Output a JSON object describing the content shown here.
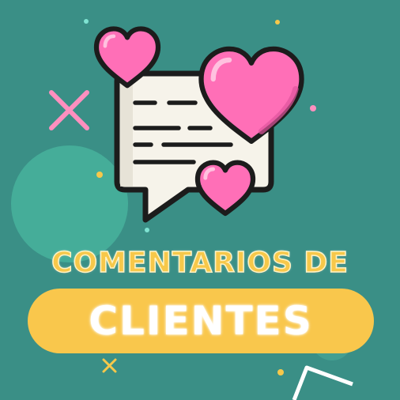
{
  "title": {
    "line1": "COMENTARIOS DE",
    "line2": "CLIENTES"
  },
  "icon_names": [
    "speech-bubble-icon",
    "heart-icon"
  ],
  "colors": {
    "background": "#3a8f86",
    "blob": "#45ad99",
    "heart": "#ff6fb7",
    "bubble": "#f6f3ea",
    "outline": "#1c1c1c",
    "title_yellow": "#f7c84a",
    "pill_yellow": "#f9c74c",
    "accent_pink": "#ff8fbf"
  }
}
